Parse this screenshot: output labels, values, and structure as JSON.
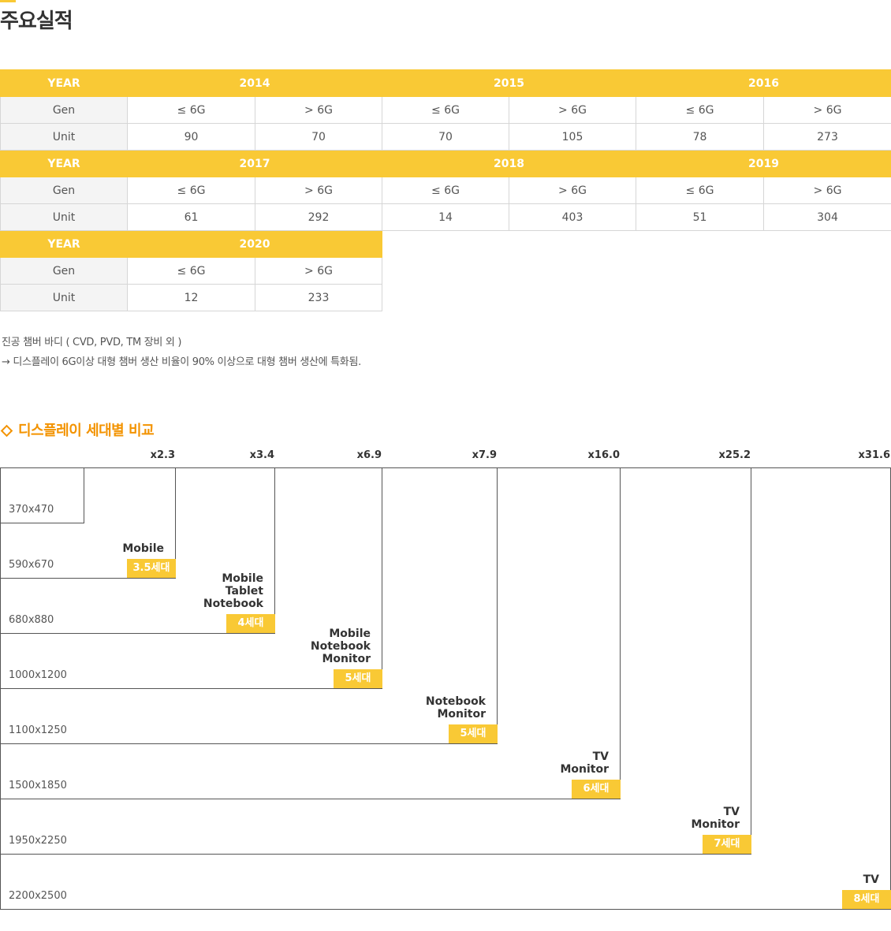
{
  "page_title": "주요실적",
  "colors": {
    "accent": "#f9c935",
    "orange": "#f39300",
    "line": "#555555"
  },
  "table": {
    "year_label": "YEAR",
    "gen_label": "Gen",
    "unit_label": "Unit",
    "gen_low": "≤ 6G",
    "gen_high": "> 6G",
    "years": [
      {
        "year": "2014",
        "low": "90",
        "high": "70"
      },
      {
        "year": "2015",
        "low": "70",
        "high": "105"
      },
      {
        "year": "2016",
        "low": "78",
        "high": "273"
      },
      {
        "year": "2017",
        "low": "61",
        "high": "292"
      },
      {
        "year": "2018",
        "low": "14",
        "high": "403"
      },
      {
        "year": "2019",
        "low": "51",
        "high": "304"
      },
      {
        "year": "2020",
        "low": "12",
        "high": "233"
      }
    ]
  },
  "notes": {
    "line1": "진공 챔버 바디 ( CVD, PVD, TM 장비 외 )",
    "line2": "→  디스플레이 6G이상 대형 챔버 생산 비율이 90% 이상으로 대형 챔버 생산에 특화됨."
  },
  "comparison": {
    "title": "디스플레이 세대별 비교",
    "multipliers": [
      "x2.3",
      "x3.4",
      "x6.9",
      "x7.9",
      "x16.0",
      "x25.2",
      "x31.6"
    ],
    "generations": [
      {
        "size": "370x470",
        "apps": [],
        "gen": ""
      },
      {
        "size": "590x670",
        "apps": [
          "Mobile"
        ],
        "gen": "3.5세대"
      },
      {
        "size": "680x880",
        "apps": [
          "Mobile",
          "Tablet",
          "Notebook"
        ],
        "gen": "4세대"
      },
      {
        "size": "1000x1200",
        "apps": [
          "Mobile",
          "Notebook",
          "Monitor"
        ],
        "gen": "5세대"
      },
      {
        "size": "1100x1250",
        "apps": [
          "Notebook",
          "Monitor"
        ],
        "gen": "5세대"
      },
      {
        "size": "1500x1850",
        "apps": [
          "TV",
          "Monitor"
        ],
        "gen": "6세대"
      },
      {
        "size": "1950x2250",
        "apps": [
          "TV",
          "Monitor"
        ],
        "gen": "7세대"
      },
      {
        "size": "2200x2500",
        "apps": [
          "TV"
        ],
        "gen": "8세대"
      }
    ]
  }
}
